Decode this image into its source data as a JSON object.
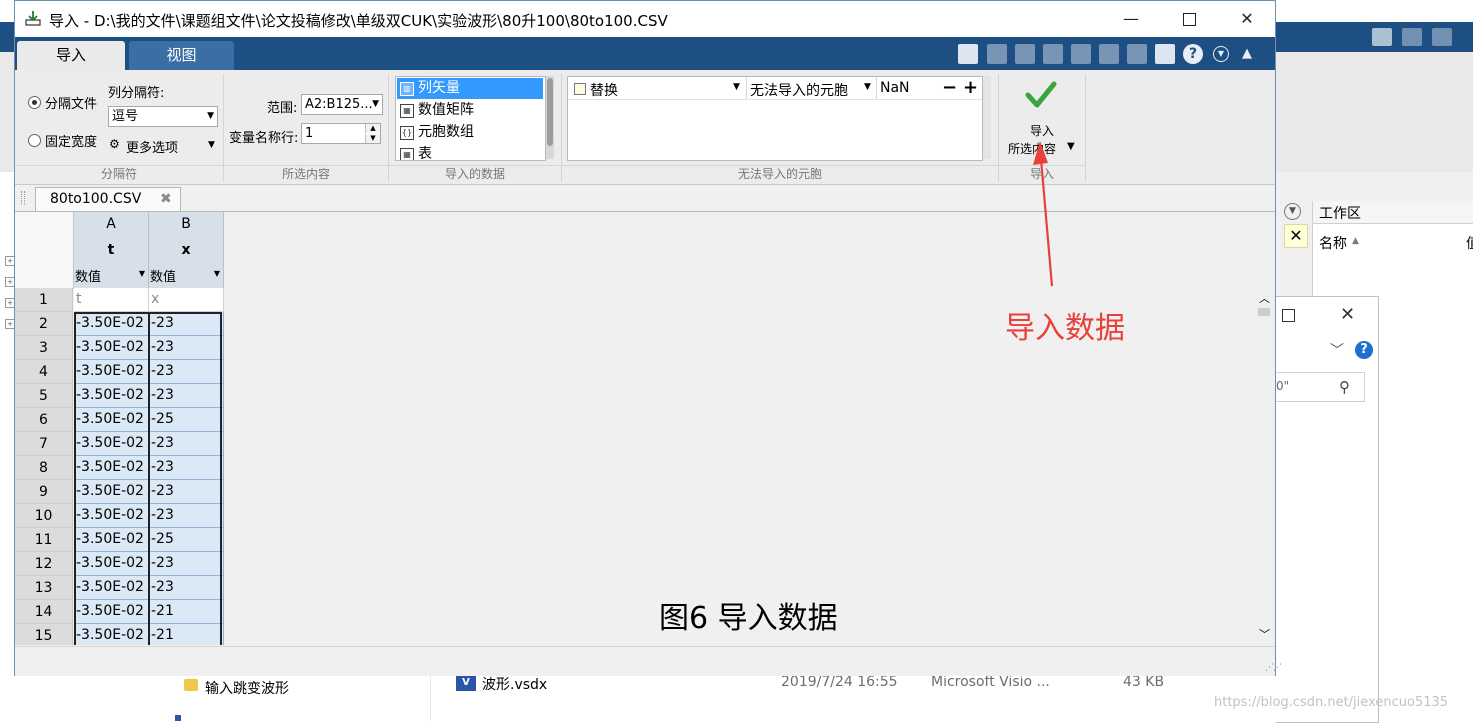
{
  "window": {
    "title": "导入 - D:\\我的文件\\课题组文件\\论文投稿修改\\单级双CUK\\实验波形\\80升100\\80to100.CSV",
    "min_glyph": "—",
    "close_glyph": "✕"
  },
  "tabs": {
    "import": "导入",
    "view": "视图"
  },
  "ribbon": {
    "delimiter_section": {
      "label": "分隔符",
      "radio_delimited": "分隔文件",
      "radio_fixed": "固定宽度",
      "delimiter_label": "列分隔符:",
      "delimiter_value": "逗号",
      "more_options": "更多选项",
      "selected": "delimited"
    },
    "selection_section": {
      "label": "所选内容",
      "range_label": "范围:",
      "range_value": "A2:B125...",
      "varnames_label": "变量名称行:",
      "varnames_value": "1"
    },
    "output_section": {
      "label": "导入的数据",
      "items": [
        "列矢量",
        "数值矩阵",
        "元胞数组",
        "表"
      ],
      "selected_index": 0
    },
    "unimportable_section": {
      "label": "无法导入的元胞",
      "rule_action": "替换",
      "rule_target": "无法导入的元胞",
      "rule_value": "NaN"
    },
    "import_section": {
      "label": "导入",
      "button_line1": "导入",
      "button_line2": "所选内容"
    }
  },
  "document_tab": {
    "label": "80to100.CSV"
  },
  "sheet": {
    "columns": [
      {
        "letter": "A",
        "var": "t",
        "type": "数值",
        "header_cell": "t"
      },
      {
        "letter": "B",
        "var": "x",
        "type": "数值",
        "header_cell": "x"
      }
    ],
    "rows": [
      {
        "n": "1"
      },
      {
        "n": "2",
        "a": "-3.50E-02",
        "b": "-23"
      },
      {
        "n": "3",
        "a": "-3.50E-02",
        "b": "-23"
      },
      {
        "n": "4",
        "a": "-3.50E-02",
        "b": "-23"
      },
      {
        "n": "5",
        "a": "-3.50E-02",
        "b": "-23"
      },
      {
        "n": "6",
        "a": "-3.50E-02",
        "b": "-25"
      },
      {
        "n": "7",
        "a": "-3.50E-02",
        "b": "-23"
      },
      {
        "n": "8",
        "a": "-3.50E-02",
        "b": "-23"
      },
      {
        "n": "9",
        "a": "-3.50E-02",
        "b": "-23"
      },
      {
        "n": "10",
        "a": "-3.50E-02",
        "b": "-23"
      },
      {
        "n": "11",
        "a": "-3.50E-02",
        "b": "-25"
      },
      {
        "n": "12",
        "a": "-3.50E-02",
        "b": "-23"
      },
      {
        "n": "13",
        "a": "-3.50E-02",
        "b": "-23"
      },
      {
        "n": "14",
        "a": "-3.50E-02",
        "b": "-21"
      },
      {
        "n": "15",
        "a": "-3.50E-02",
        "b": "-21"
      }
    ]
  },
  "annotation": {
    "text": "导入数据",
    "color": "#e8403a"
  },
  "caption": "图6  导入数据",
  "background": {
    "workspace_title": "工作区",
    "workspace_col_name": "名称",
    "workspace_col_2": "值",
    "search_hint": "0\"",
    "explorer": {
      "folder": "输入跳变波形",
      "file_name": "波形.vsdx",
      "file_date": "2019/7/24 16:55",
      "file_type": "Microsoft Visio ...",
      "file_size": "43 KB",
      "file_icon_letter": "V"
    },
    "watermark": "https://blog.csdn.net/jiexencuo5135"
  },
  "colors": {
    "ribbon_blue": "#1e4f82",
    "selection_blue": "#3399ff",
    "cell_fill": "#dbe8f5",
    "check_green": "#3aa53a"
  }
}
